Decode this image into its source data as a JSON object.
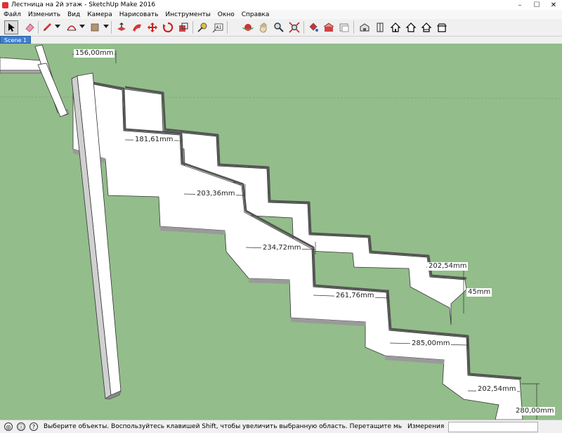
{
  "window": {
    "title": "Лестница на 2й этаж - SketchUp Make 2016"
  },
  "menu": [
    "Файл",
    "Изменить",
    "Вид",
    "Камера",
    "Нарисовать",
    "Инструменты",
    "Окно",
    "Справка"
  ],
  "scene": {
    "tab_label": "Scene 1"
  },
  "dimensions": [
    "156,00mm",
    "181,61mm",
    "203,36mm",
    "234,72mm",
    "261,76mm",
    "285,00mm",
    "202,54mm",
    "280,00mm",
    "202,54mm",
    "45mm"
  ],
  "status": {
    "text": "Выберите объекты. Воспользуйтесь клавишей Shift, чтобы увеличить выбранную область. Перетащите мышь, чтобы выбрать несколько объе...",
    "measurement_label": "Измерения"
  },
  "colors": {
    "viewport_bg": "#93bd8b",
    "scene_tab": "#3d7fd1"
  }
}
